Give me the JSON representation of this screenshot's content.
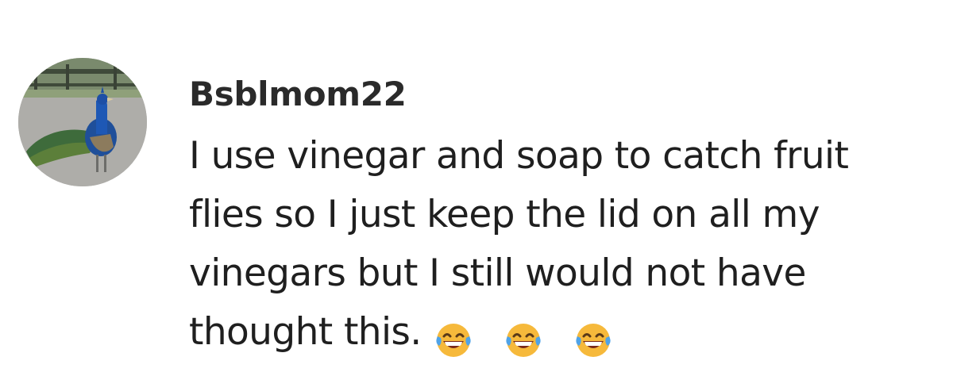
{
  "comment": {
    "username": "Bsblmom22",
    "avatar_icon": "peacock-avatar-icon",
    "lines": [
      "I use vinegar and soap to catch fruit",
      "flies so I just keep the lid on all my",
      "vinegars but I still would not have",
      "thought this."
    ],
    "emojis": [
      "laughing-crying-emoji",
      "laughing-crying-emoji",
      "laughing-crying-emoji"
    ]
  }
}
